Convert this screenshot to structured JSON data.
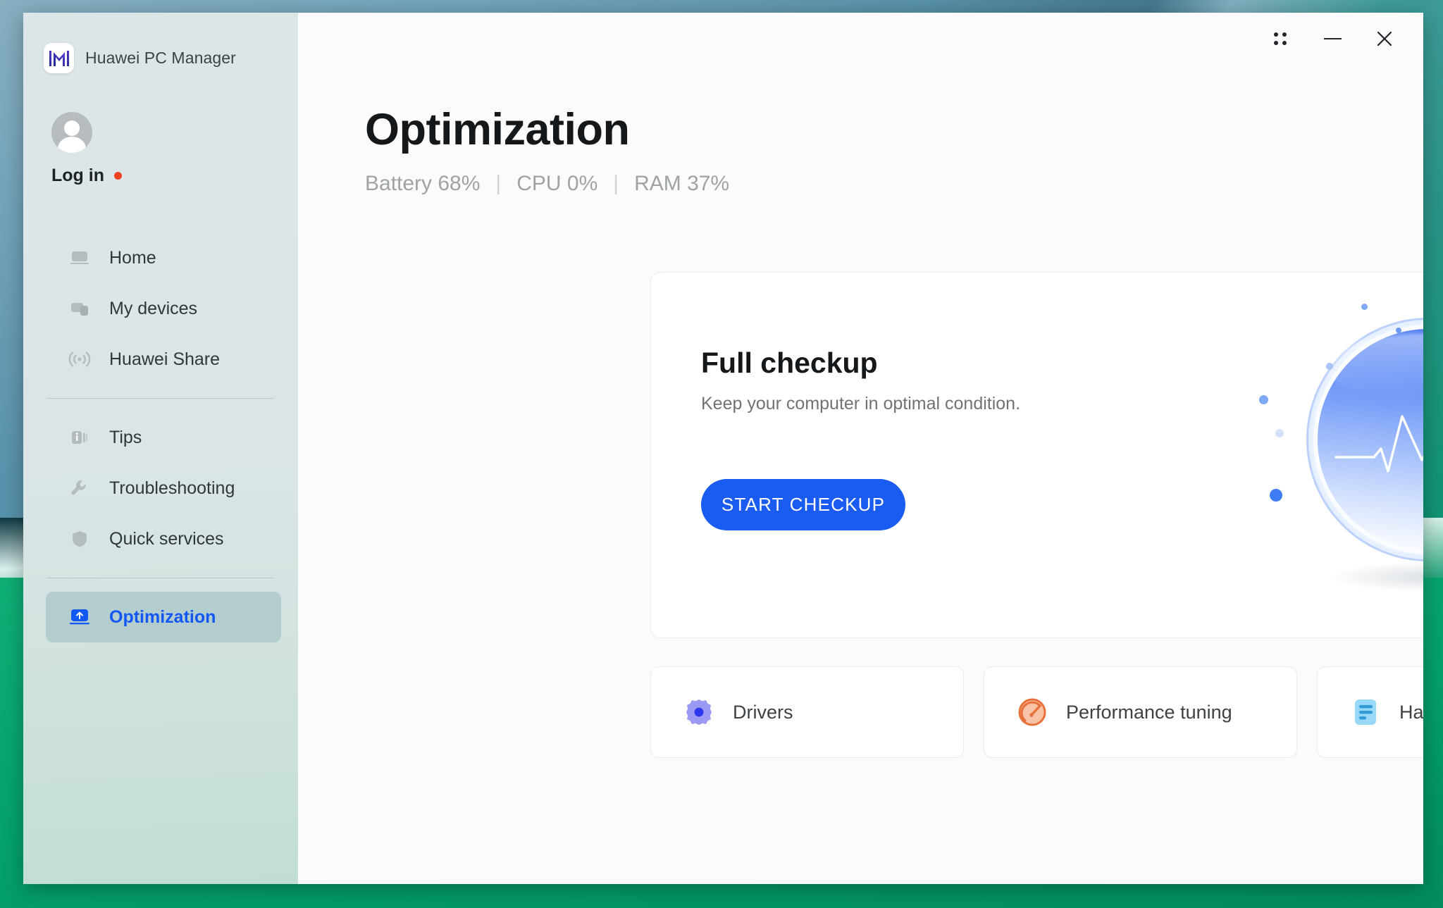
{
  "desktop": {
    "wallpaper_colors": [
      "#5d93ad",
      "#0f3f49",
      "#04a06b"
    ]
  },
  "window": {
    "brand": {
      "name": "Huawei PC Manager",
      "logo_icon": "huawei-m-logo"
    },
    "controls": [
      {
        "name": "dots-grid-icon",
        "label": ""
      },
      {
        "name": "minimize-icon",
        "label": ""
      },
      {
        "name": "close-icon",
        "label": "✕"
      }
    ]
  },
  "sidebar": {
    "account": {
      "label": "Log in",
      "badge_color": "#ef4123",
      "avatar_icon": "user-avatar-icon"
    },
    "groups": [
      {
        "items": [
          {
            "label": "Home",
            "icon": "laptop-icon",
            "active": false
          },
          {
            "label": "My devices",
            "icon": "devices-icon",
            "active": false
          },
          {
            "label": "Huawei Share",
            "icon": "share-waves-icon",
            "active": false
          }
        ]
      },
      {
        "items": [
          {
            "label": "Tips",
            "icon": "info-cards-icon",
            "active": false
          },
          {
            "label": "Troubleshooting",
            "icon": "wrench-icon",
            "active": false
          },
          {
            "label": "Quick services",
            "icon": "shield-icon",
            "active": false
          }
        ]
      },
      {
        "items": [
          {
            "label": "Optimization",
            "icon": "optimization-icon",
            "active": true
          }
        ]
      }
    ]
  },
  "main": {
    "title": "Optimization",
    "stats": [
      {
        "label": "Battery 68%"
      },
      {
        "label": "CPU 0%"
      },
      {
        "label": "RAM 37%"
      }
    ],
    "stat_separator": "|",
    "hero": {
      "title": "Full checkup",
      "subtitle": "Keep your computer in optimal condition.",
      "button_label": "START CHECKUP",
      "button_color": "#1a5cf2",
      "art_icon": "pulse-orb-graphic"
    },
    "tiles": [
      {
        "label": "Drivers",
        "icon": "gear-icon",
        "color": "#5b5bf0"
      },
      {
        "label": "Performance tuning",
        "icon": "speedometer-icon",
        "color": "#e8703a"
      },
      {
        "label": "Hardware info",
        "icon": "document-lines-icon",
        "color": "#3aa9e8"
      }
    ]
  }
}
